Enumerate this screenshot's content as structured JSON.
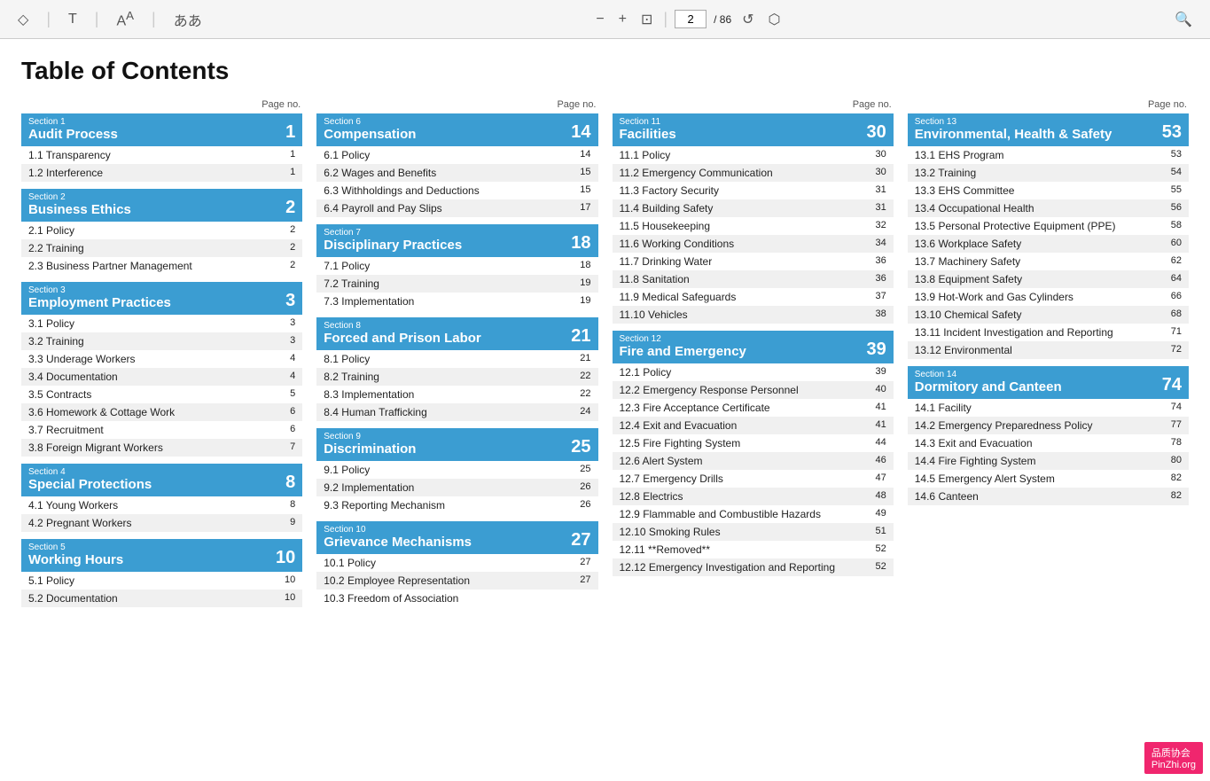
{
  "toolbar": {
    "page_current": "2",
    "page_total": "86",
    "icons": [
      "diamond",
      "T",
      "A↑",
      "あア",
      "−",
      "+",
      "⊡",
      "↺",
      "⬡",
      "🔍"
    ]
  },
  "title": "Table of Contents",
  "columns": [
    {
      "page_no_label": "Page no.",
      "sections": [
        {
          "label": "Section 1",
          "title": "Audit Process",
          "num": "1",
          "items": [
            {
              "label": "1.1 Transparency",
              "page": "1"
            },
            {
              "label": "1.2 Interference",
              "page": "1"
            }
          ]
        },
        {
          "label": "Section 2",
          "title": "Business Ethics",
          "num": "2",
          "items": [
            {
              "label": "2.1 Policy",
              "page": "2"
            },
            {
              "label": "2.2 Training",
              "page": "2"
            },
            {
              "label": "2.3 Business Partner Management",
              "page": "2"
            }
          ]
        },
        {
          "label": "Section 3",
          "title": "Employment Practices",
          "num": "3",
          "items": [
            {
              "label": "3.1 Policy",
              "page": "3"
            },
            {
              "label": "3.2 Training",
              "page": "3"
            },
            {
              "label": "3.3 Underage Workers",
              "page": "4"
            },
            {
              "label": "3.4 Documentation",
              "page": "4"
            },
            {
              "label": "3.5 Contracts",
              "page": "5"
            },
            {
              "label": "3.6 Homework & Cottage Work",
              "page": "6"
            },
            {
              "label": "3.7 Recruitment",
              "page": "6"
            },
            {
              "label": "3.8 Foreign Migrant Workers",
              "page": "7"
            }
          ]
        },
        {
          "label": "Section 4",
          "title": "Special Protections",
          "num": "8",
          "items": [
            {
              "label": "4.1 Young Workers",
              "page": "8"
            },
            {
              "label": "4.2 Pregnant Workers",
              "page": "9"
            }
          ]
        },
        {
          "label": "Section 5",
          "title": "Working Hours",
          "num": "10",
          "items": [
            {
              "label": "5.1 Policy",
              "page": "10"
            },
            {
              "label": "5.2 Documentation",
              "page": "10"
            }
          ]
        }
      ]
    },
    {
      "page_no_label": "Page no.",
      "sections": [
        {
          "label": "Section 6",
          "title": "Compensation",
          "num": "14",
          "items": [
            {
              "label": "6.1 Policy",
              "page": "14"
            },
            {
              "label": "6.2 Wages and Benefits",
              "page": "15"
            },
            {
              "label": "6.3 Withholdings and Deductions",
              "page": "15"
            },
            {
              "label": "6.4 Payroll and Pay Slips",
              "page": "17"
            }
          ]
        },
        {
          "label": "Section 7",
          "title": "Disciplinary Practices",
          "num": "18",
          "items": [
            {
              "label": "7.1 Policy",
              "page": "18"
            },
            {
              "label": "7.2 Training",
              "page": "19"
            },
            {
              "label": "7.3 Implementation",
              "page": "19"
            }
          ]
        },
        {
          "label": "Section 8",
          "title": "Forced and Prison Labor",
          "num": "21",
          "items": [
            {
              "label": "8.1 Policy",
              "page": "21"
            },
            {
              "label": "8.2 Training",
              "page": "22"
            },
            {
              "label": "8.3 Implementation",
              "page": "22"
            },
            {
              "label": "8.4 Human Trafficking",
              "page": "24"
            }
          ]
        },
        {
          "label": "Section 9",
          "title": "Discrimination",
          "num": "25",
          "items": [
            {
              "label": "9.1 Policy",
              "page": "25"
            },
            {
              "label": "9.2 Implementation",
              "page": "26"
            },
            {
              "label": "9.3 Reporting Mechanism",
              "page": "26"
            }
          ]
        },
        {
          "label": "Section 10",
          "title": "Grievance Mechanisms",
          "num": "27",
          "items": [
            {
              "label": "10.1 Policy",
              "page": "27"
            },
            {
              "label": "10.2 Employee Representation",
              "page": "27"
            },
            {
              "label": "10.3 Freedom of Association",
              "page": ""
            }
          ]
        }
      ]
    },
    {
      "page_no_label": "Page no.",
      "sections": [
        {
          "label": "Section 11",
          "title": "Facilities",
          "num": "30",
          "items": [
            {
              "label": "11.1 Policy",
              "page": "30"
            },
            {
              "label": "11.2 Emergency Communication",
              "page": "30"
            },
            {
              "label": "11.3 Factory Security",
              "page": "31"
            },
            {
              "label": "11.4 Building Safety",
              "page": "31"
            },
            {
              "label": "11.5 Housekeeping",
              "page": "32"
            },
            {
              "label": "11.6 Working Conditions",
              "page": "34"
            },
            {
              "label": "11.7 Drinking Water",
              "page": "36"
            },
            {
              "label": "11.8 Sanitation",
              "page": "36"
            },
            {
              "label": "11.9 Medical Safeguards",
              "page": "37"
            },
            {
              "label": "11.10 Vehicles",
              "page": "38"
            }
          ]
        },
        {
          "label": "Section 12",
          "title": "Fire and Emergency",
          "num": "39",
          "items": [
            {
              "label": "12.1 Policy",
              "page": "39"
            },
            {
              "label": "12.2 Emergency Response Personnel",
              "page": "40"
            },
            {
              "label": "12.3 Fire Acceptance Certificate",
              "page": "41"
            },
            {
              "label": "12.4 Exit and Evacuation",
              "page": "41"
            },
            {
              "label": "12.5 Fire Fighting System",
              "page": "44"
            },
            {
              "label": "12.6 Alert System",
              "page": "46"
            },
            {
              "label": "12.7 Emergency Drills",
              "page": "47"
            },
            {
              "label": "12.8 Electrics",
              "page": "48"
            },
            {
              "label": "12.9 Flammable and Combustible Hazards",
              "page": "49"
            },
            {
              "label": "12.10 Smoking Rules",
              "page": "51"
            },
            {
              "label": "12.11  **Removed**",
              "page": "52"
            },
            {
              "label": "12.12 Emergency Investigation and Reporting",
              "page": "52"
            }
          ]
        }
      ]
    },
    {
      "page_no_label": "Page no.",
      "sections": [
        {
          "label": "Section 13",
          "title": "Environmental, Health & Safety",
          "num": "53",
          "items": [
            {
              "label": "13.1 EHS Program",
              "page": "53"
            },
            {
              "label": "13.2 Training",
              "page": "54"
            },
            {
              "label": "13.3 EHS Committee",
              "page": "55"
            },
            {
              "label": "13.4 Occupational Health",
              "page": "56"
            },
            {
              "label": "13.5 Personal Protective Equipment (PPE)",
              "page": "58"
            },
            {
              "label": "13.6 Workplace Safety",
              "page": "60"
            },
            {
              "label": "13.7 Machinery Safety",
              "page": "62"
            },
            {
              "label": "13.8 Equipment Safety",
              "page": "64"
            },
            {
              "label": "13.9 Hot-Work and Gas Cylinders",
              "page": "66"
            },
            {
              "label": "13.10 Chemical Safety",
              "page": "68"
            },
            {
              "label": "13.11 Incident Investigation and Reporting",
              "page": "71"
            },
            {
              "label": "13.12 Environmental",
              "page": "72"
            }
          ]
        },
        {
          "label": "Section 14",
          "title": "Dormitory and Canteen",
          "num": "74",
          "items": [
            {
              "label": "14.1 Facility",
              "page": "74"
            },
            {
              "label": "14.2 Emergency Preparedness Policy",
              "page": "77"
            },
            {
              "label": "14.3 Exit and Evacuation",
              "page": "78"
            },
            {
              "label": "14.4 Fire Fighting System",
              "page": "80"
            },
            {
              "label": "14.5 Emergency Alert System",
              "page": "82"
            },
            {
              "label": "14.6 Canteen",
              "page": "82"
            }
          ]
        }
      ]
    }
  ]
}
